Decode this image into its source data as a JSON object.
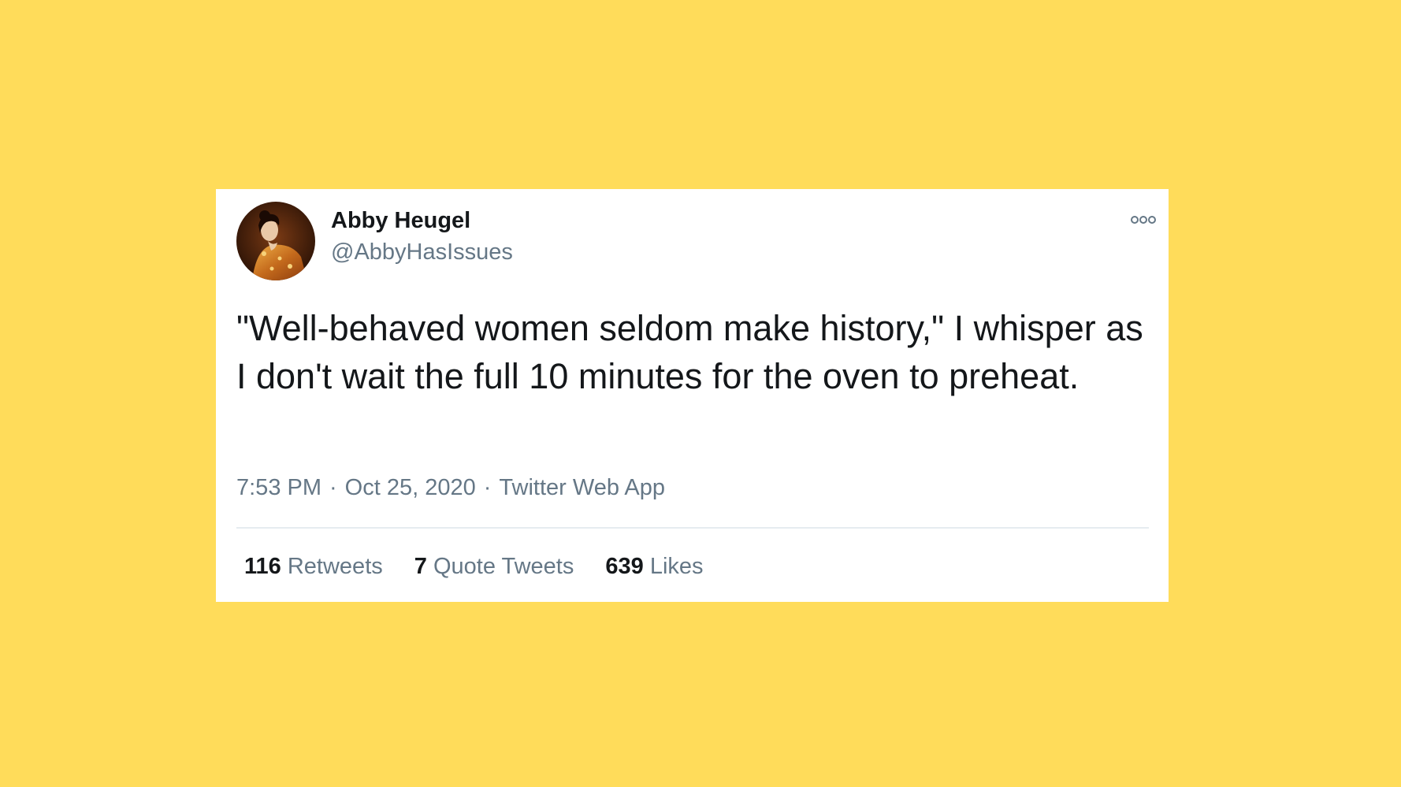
{
  "tweet": {
    "author": {
      "display_name": "Abby Heugel",
      "handle": "@AbbyHasIssues"
    },
    "text": "\"Well-behaved women seldom make history,\" I whisper as I don't wait the full 10 minutes for the oven to preheat.",
    "time": "7:53 PM",
    "date": "Oct 25, 2020",
    "source": "Twitter Web App",
    "separator": "·",
    "stats": {
      "retweets_count": "116",
      "retweets_label": "Retweets",
      "quote_tweets_count": "7",
      "quote_tweets_label": "Quote Tweets",
      "likes_count": "639",
      "likes_label": "Likes"
    }
  },
  "icons": {
    "more": "more-options-icon",
    "avatar": "avatar-image"
  },
  "colors": {
    "background": "#FFDC5A",
    "card": "#FFFFFF",
    "text_primary": "#14171A",
    "text_secondary": "#657786",
    "divider": "#E6ECF0"
  }
}
